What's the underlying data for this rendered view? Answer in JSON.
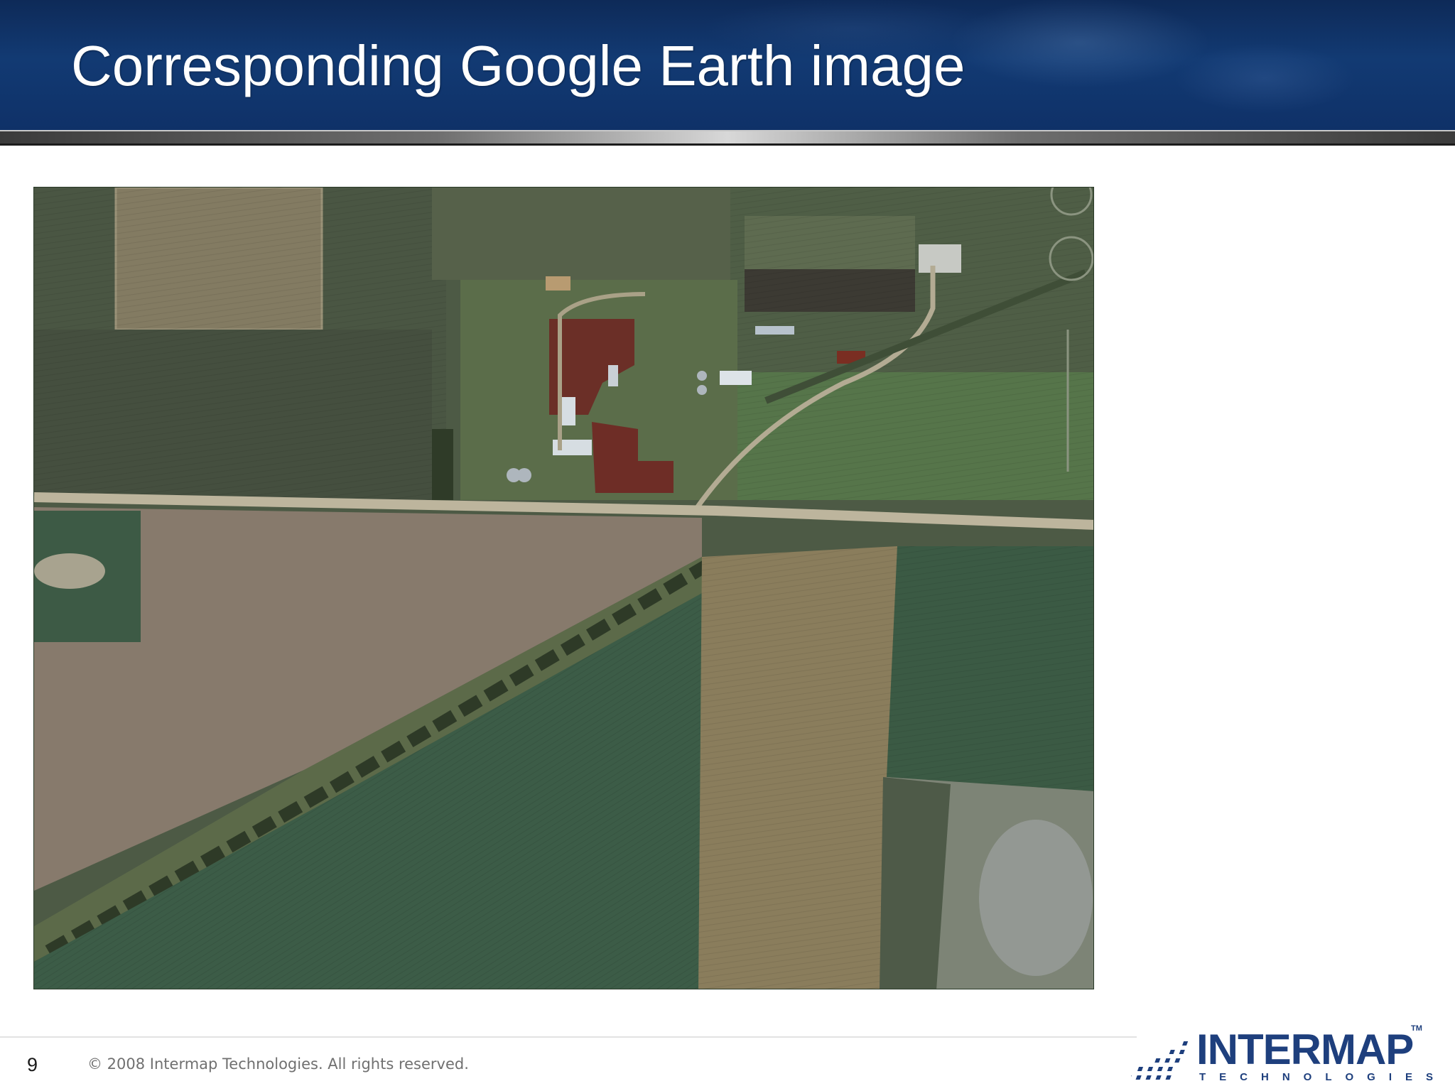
{
  "slide": {
    "title": "Corresponding Google Earth image",
    "page_number": "9",
    "copyright": "© 2008 Intermap Technologies. All rights reserved."
  },
  "image": {
    "icon": "satellite-farmland-photo"
  },
  "logo": {
    "name": "INTERMAP",
    "sub": "TECHNOLOGIES",
    "tm": "TM",
    "color": "#1e3f7d"
  }
}
